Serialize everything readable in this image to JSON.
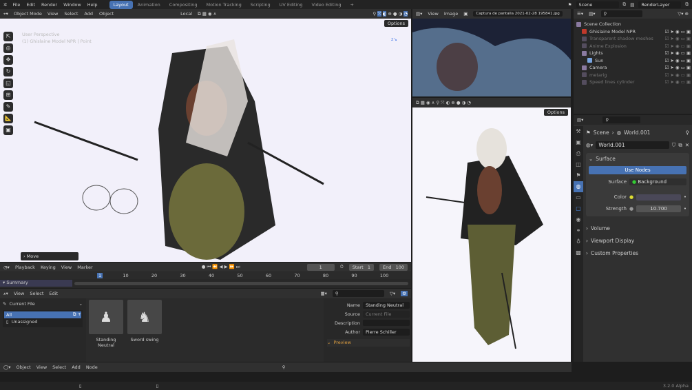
{
  "topbar": {
    "menus": [
      "File",
      "Edit",
      "Render",
      "Window",
      "Help"
    ],
    "workspaces": [
      "Layout",
      "Animation",
      "Compositing",
      "Motion Tracking",
      "Scripting",
      "UV Editing",
      "Video Editing",
      "+"
    ],
    "active_workspace": "Layout",
    "scene": "Scene",
    "view_layer": "RenderLayer"
  },
  "viewport": {
    "mode": "Object Mode",
    "menus": [
      "View",
      "Select",
      "Add",
      "Object"
    ],
    "transform_orientation": "Local",
    "options": "Options",
    "overlay_line1": "User Perspective",
    "overlay_line2": "(1) Ghislaine Model NPR | Point",
    "last_op": "Move",
    "bg": "#f2f0fa"
  },
  "image_editor": {
    "menus": [
      "View",
      "Image"
    ],
    "image_name": "Captura de pantalla 2021-02-28 195841.jpg"
  },
  "viewport2": {
    "options": "Options"
  },
  "outliner": {
    "items": [
      {
        "label": "Scene Collection",
        "depth": 0,
        "dim": false
      },
      {
        "label": "Ghislaine Model NPR",
        "depth": 1,
        "dim": false
      },
      {
        "label": "Transparent shadow meshes",
        "depth": 1,
        "dim": true
      },
      {
        "label": "Anime Explosion",
        "depth": 1,
        "dim": true
      },
      {
        "label": "Lights",
        "depth": 1,
        "dim": false
      },
      {
        "label": "Sun",
        "depth": 2,
        "dim": false
      },
      {
        "label": "Camera",
        "depth": 1,
        "dim": false
      },
      {
        "label": "metarig",
        "depth": 1,
        "dim": true
      },
      {
        "label": "Speed lines cylinder",
        "depth": 1,
        "dim": true
      }
    ]
  },
  "properties": {
    "breadcrumb_scene": "Scene",
    "breadcrumb_world": "World.001",
    "world_name": "World.001",
    "surface_panel": "Surface",
    "use_nodes": "Use Nodes",
    "surface_label": "Surface",
    "surface_value": "Background",
    "color_label": "Color",
    "color_value": "#4a4858",
    "strength_label": "Strength",
    "strength_value": "10.700",
    "panels": [
      "Volume",
      "Viewport Display",
      "Custom Properties"
    ]
  },
  "timeline": {
    "menus": [
      "Playback",
      "Keying",
      "View",
      "Marker"
    ],
    "current_frame": "1",
    "start_label": "Start",
    "start": "1",
    "end_label": "End",
    "end": "100",
    "ticks": [
      "1",
      "10",
      "20",
      "30",
      "40",
      "50",
      "60",
      "70",
      "80",
      "90",
      "100"
    ],
    "summary": "Summary"
  },
  "asset_browser": {
    "menus": [
      "View",
      "Select",
      "Edit"
    ],
    "library": "Current File",
    "catalogs": [
      "All",
      "Unassigned"
    ],
    "assets": [
      "Standing Neutral",
      "Sword swing"
    ],
    "meta": {
      "name_label": "Name",
      "name": "Standing Neutral",
      "source_label": "Source",
      "source": "Current File",
      "description_label": "Description",
      "description": "",
      "author_label": "Author",
      "author": "Pierre Schiller"
    },
    "preview": "Preview"
  },
  "node_editor": {
    "type": "Object",
    "menus": [
      "View",
      "Select",
      "Add",
      "Node"
    ]
  },
  "status": {
    "version": "3.2.0 Alpha"
  }
}
